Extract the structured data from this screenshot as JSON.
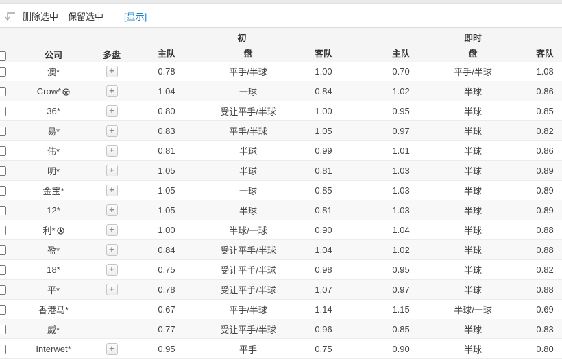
{
  "toolbar": {
    "delete_selected_label": "删除选中",
    "keep_selected_label": "保留选中",
    "show_label": "[显示]"
  },
  "colors": {
    "link_blue": "#1a85c8",
    "header_bg": "#f5f5f5",
    "row_alt_bg": "#f8f8f8",
    "top_strip": "#e9e9e9"
  },
  "table": {
    "group_headers": {
      "initial": "初",
      "live": "即时"
    },
    "columns": {
      "company": "公司",
      "multi": "多盘",
      "home": "主队",
      "handicap": "盘",
      "away": "客队"
    },
    "multi_expand_label": "+",
    "rows": [
      {
        "company": "澳*",
        "ball": false,
        "has_plus": true,
        "init_home": "0.78",
        "init_handicap": "平手/半球",
        "init_away": "1.00",
        "live_home": "0.70",
        "live_handicap": "平手/半球",
        "live_away": "1.08"
      },
      {
        "company": "Crow*",
        "ball": true,
        "has_plus": true,
        "init_home": "1.04",
        "init_handicap": "一球",
        "init_away": "0.84",
        "live_home": "1.02",
        "live_handicap": "半球",
        "live_away": "0.86"
      },
      {
        "company": "36*",
        "ball": false,
        "has_plus": true,
        "init_home": "0.80",
        "init_handicap": "受让平手/半球",
        "init_away": "1.00",
        "live_home": "0.95",
        "live_handicap": "半球",
        "live_away": "0.85"
      },
      {
        "company": "易*",
        "ball": false,
        "has_plus": true,
        "init_home": "0.83",
        "init_handicap": "平手/半球",
        "init_away": "1.05",
        "live_home": "0.97",
        "live_handicap": "半球",
        "live_away": "0.82"
      },
      {
        "company": "伟*",
        "ball": false,
        "has_plus": true,
        "init_home": "0.81",
        "init_handicap": "半球",
        "init_away": "0.99",
        "live_home": "1.01",
        "live_handicap": "半球",
        "live_away": "0.86"
      },
      {
        "company": "明*",
        "ball": false,
        "has_plus": true,
        "init_home": "1.05",
        "init_handicap": "半球",
        "init_away": "0.81",
        "live_home": "1.03",
        "live_handicap": "半球",
        "live_away": "0.89"
      },
      {
        "company": "金宝*",
        "ball": false,
        "has_plus": true,
        "init_home": "1.05",
        "init_handicap": "一球",
        "init_away": "0.85",
        "live_home": "1.03",
        "live_handicap": "半球",
        "live_away": "0.89"
      },
      {
        "company": "12*",
        "ball": false,
        "has_plus": true,
        "init_home": "1.05",
        "init_handicap": "半球",
        "init_away": "0.81",
        "live_home": "1.03",
        "live_handicap": "半球",
        "live_away": "0.89"
      },
      {
        "company": "利*",
        "ball": true,
        "has_plus": true,
        "init_home": "1.00",
        "init_handicap": "半球/一球",
        "init_away": "0.90",
        "live_home": "1.04",
        "live_handicap": "半球",
        "live_away": "0.88"
      },
      {
        "company": "盈*",
        "ball": false,
        "has_plus": true,
        "init_home": "0.84",
        "init_handicap": "受让平手/半球",
        "init_away": "1.04",
        "live_home": "1.02",
        "live_handicap": "半球",
        "live_away": "0.88"
      },
      {
        "company": "18*",
        "ball": false,
        "has_plus": true,
        "init_home": "0.75",
        "init_handicap": "受让平手/半球",
        "init_away": "0.98",
        "live_home": "0.95",
        "live_handicap": "半球",
        "live_away": "0.82"
      },
      {
        "company": "平*",
        "ball": false,
        "has_plus": true,
        "init_home": "0.78",
        "init_handicap": "受让平手/半球",
        "init_away": "1.07",
        "live_home": "0.97",
        "live_handicap": "半球",
        "live_away": "0.88"
      },
      {
        "company": "香港马*",
        "ball": false,
        "has_plus": false,
        "init_home": "0.67",
        "init_handicap": "平手/半球",
        "init_away": "1.14",
        "live_home": "1.15",
        "live_handicap": "半球/一球",
        "live_away": "0.69"
      },
      {
        "company": "威*",
        "ball": false,
        "has_plus": false,
        "init_home": "0.77",
        "init_handicap": "受让平手/半球",
        "init_away": "0.96",
        "live_home": "0.85",
        "live_handicap": "半球",
        "live_away": "0.83"
      },
      {
        "company": "Interwet*",
        "ball": false,
        "has_plus": true,
        "init_home": "0.95",
        "init_handicap": "平手",
        "init_away": "0.75",
        "live_home": "0.90",
        "live_handicap": "半球",
        "live_away": "0.80"
      }
    ]
  }
}
